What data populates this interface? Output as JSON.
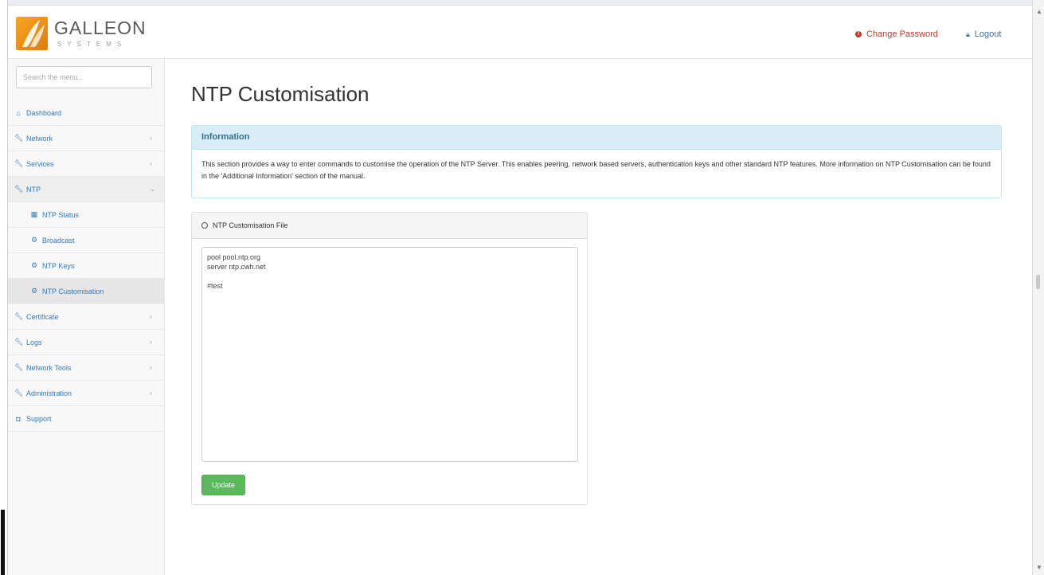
{
  "brand": {
    "name": "GALLEON",
    "tagline": "SYSTEMS"
  },
  "header": {
    "change_password": "Change Password",
    "logout": "Logout"
  },
  "sidebar": {
    "search_placeholder": "Search the menu...",
    "items": [
      {
        "label": "Dashboard",
        "icon": "dashboard-icon"
      },
      {
        "label": "Network",
        "icon": "wrench-icon",
        "caret": "‹"
      },
      {
        "label": "Services",
        "icon": "wrench-icon",
        "caret": "‹"
      },
      {
        "label": "NTP",
        "icon": "wrench-icon",
        "caret": "⌄",
        "expanded": true
      },
      {
        "label": "NTP Status",
        "icon": "table-icon",
        "sub": true
      },
      {
        "label": "Broadcast",
        "icon": "cog-icon",
        "sub": true
      },
      {
        "label": "NTP Keys",
        "icon": "cog-icon",
        "sub": true
      },
      {
        "label": "NTP Customisation",
        "icon": "cog-icon",
        "sub": true,
        "current": true
      },
      {
        "label": "Certificate",
        "icon": "wrench-icon",
        "caret": "‹"
      },
      {
        "label": "Logs",
        "icon": "wrench-icon",
        "caret": "‹"
      },
      {
        "label": "Network Tools",
        "icon": "wrench-icon",
        "caret": "‹"
      },
      {
        "label": "Administration",
        "icon": "wrench-icon",
        "caret": "‹"
      },
      {
        "label": "Support",
        "icon": "support-icon"
      }
    ]
  },
  "main": {
    "title": "NTP Customisation",
    "info": {
      "heading": "Information",
      "text": "This section provides a way to enter commands to customise the operation of the NTP Server. This enables peering, network based servers, authentication keys and other standard NTP features. More information on NTP Customisation can be found in the 'Additional Information' section of the manual."
    },
    "file_panel": {
      "heading": "NTP Customisation File",
      "content": "pool pool.ntp.org\nserver ntp.cwh.net\n\n#test",
      "button": "Update"
    }
  },
  "colors": {
    "accent": "#337ab7",
    "info_bg": "#d9edf7",
    "success": "#5cb85c",
    "danger": "#c0392b"
  }
}
